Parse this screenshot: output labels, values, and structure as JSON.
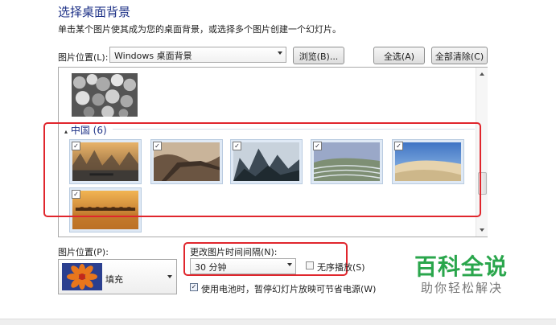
{
  "header": {
    "title": "选择桌面背景",
    "subtitle": "单击某个图片使其成为您的桌面背景，或选择多个图片创建一个幻灯片。"
  },
  "location": {
    "label": "图片位置(L):",
    "value": "Windows 桌面背景",
    "browse_label": "浏览(B)...",
    "select_all_label": "全选(A)",
    "clear_all_label": "全部清除(C)"
  },
  "gallery": {
    "group_name": "中国 (6)",
    "check_mark": "✓",
    "group_colors": {
      "highlight": "#e0262d",
      "accent": "#1e3287"
    }
  },
  "position": {
    "label": "图片位置(P):",
    "value": "填充"
  },
  "interval": {
    "label": "更改图片时间间隔(N):",
    "value": "30 分钟",
    "shuffle_label": "无序播放(S)",
    "battery_label": "使用电池时，暂停幻灯片放映可节省电源(W)",
    "battery_checked": true,
    "shuffle_checked": false
  },
  "watermark": {
    "main": "百科全说",
    "sub": "助你轻松解决"
  }
}
